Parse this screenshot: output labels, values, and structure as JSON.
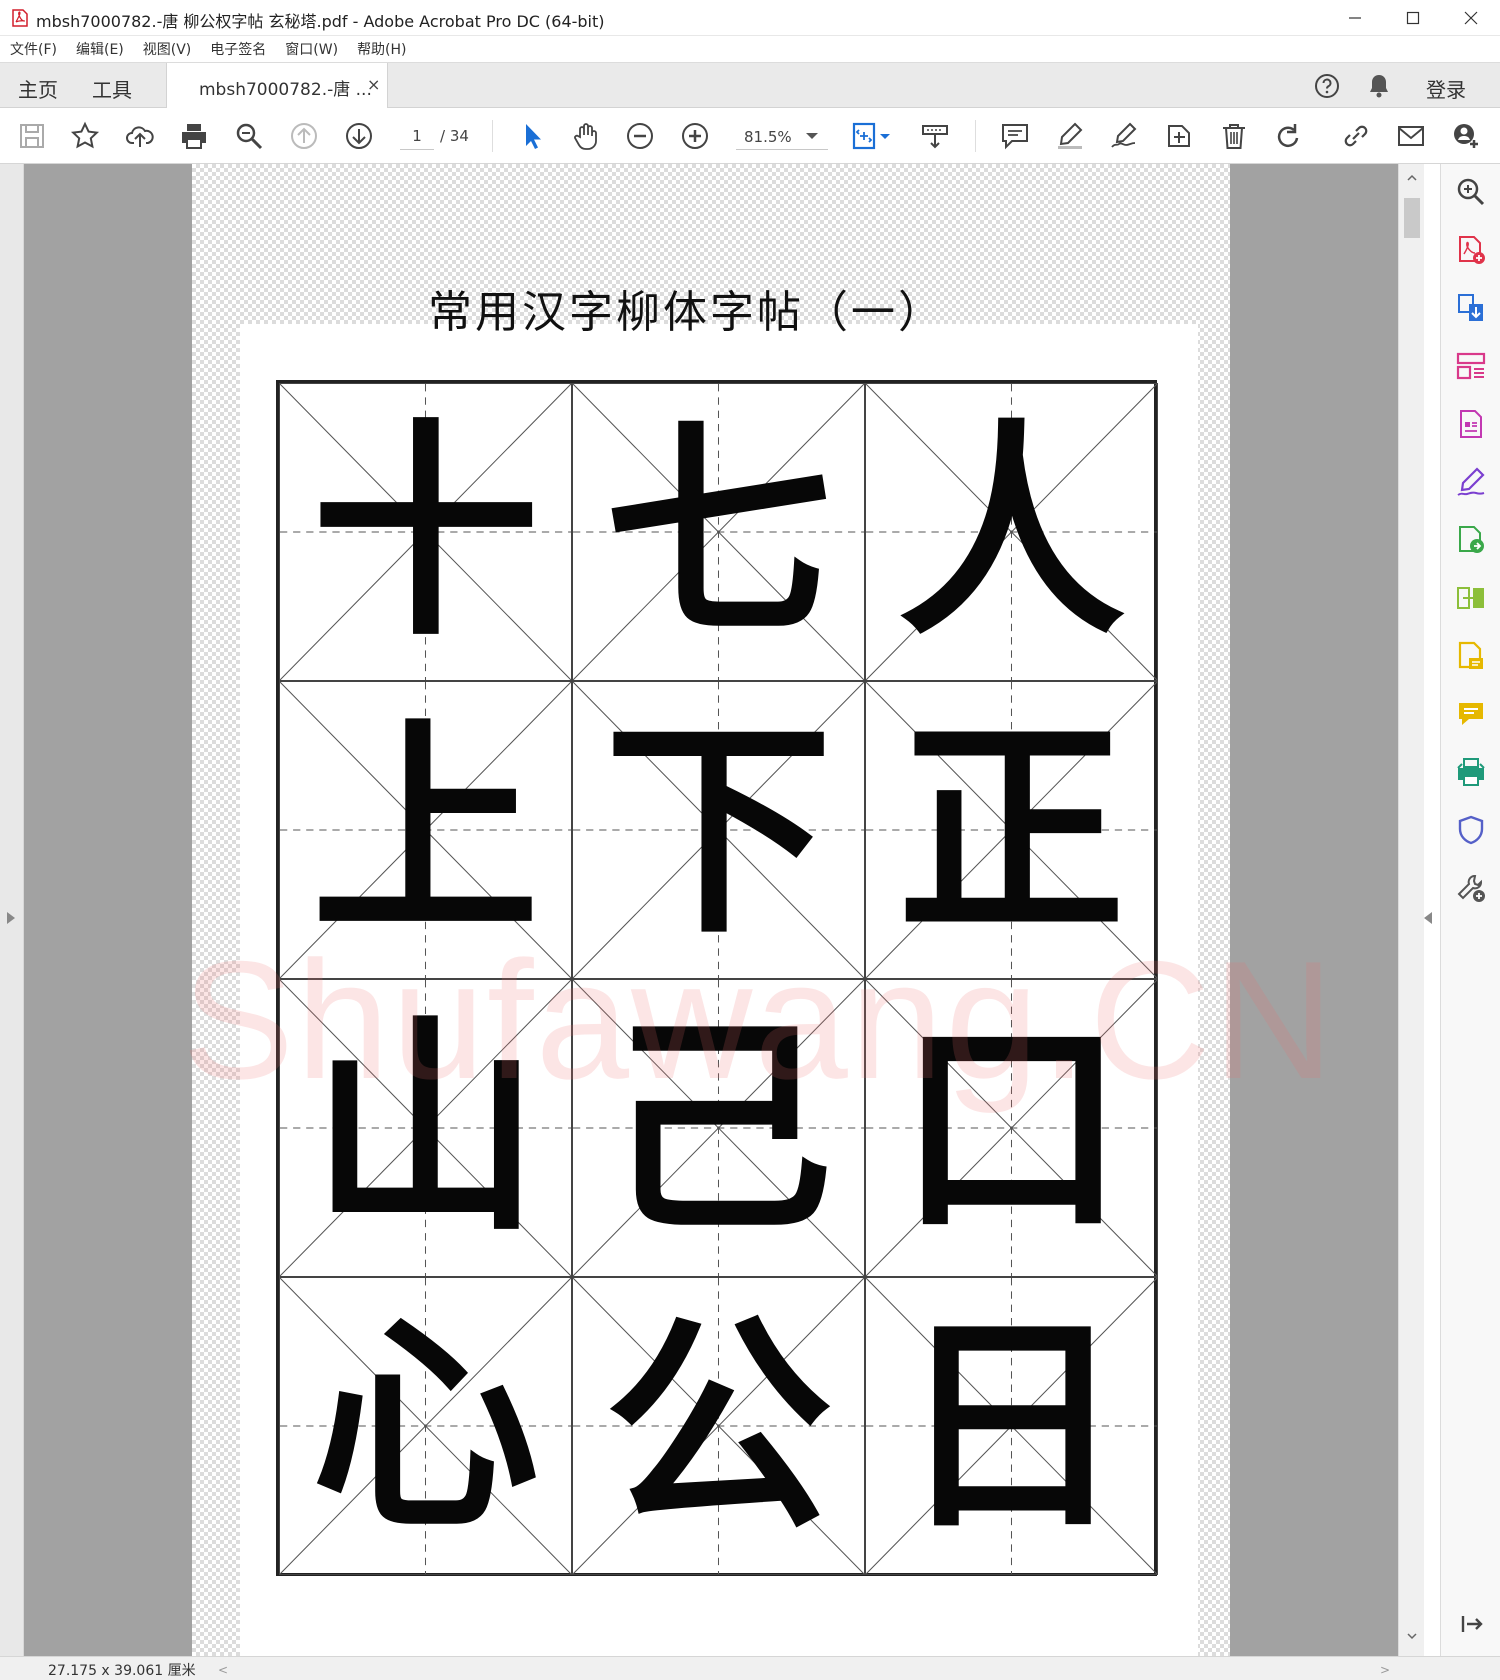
{
  "window": {
    "title": "mbsh7000782.-唐 柳公权字帖 玄秘塔.pdf - Adobe Acrobat Pro DC (64-bit)",
    "controls": [
      "minimize",
      "maximize",
      "close"
    ]
  },
  "menu": {
    "items": [
      "文件(F)",
      "编辑(E)",
      "视图(V)",
      "电子签名",
      "窗口(W)",
      "帮助(H)"
    ]
  },
  "tabs": {
    "home": "主页",
    "tools": "工具",
    "document": "mbsh7000782.-唐 ...",
    "close_symbol": "×",
    "login": "登录"
  },
  "toolbar": {
    "page_current": "1",
    "page_total": "/ 34",
    "zoom": "81.5%",
    "icons": [
      "save-icon",
      "bookmark-star-icon",
      "upload-cloud-icon",
      "print-icon",
      "find-icon",
      "page-up-icon",
      "page-down-icon",
      "select-arrow-icon",
      "hand-icon",
      "zoom-out-icon",
      "zoom-in-icon",
      "page-display-icon",
      "keyboard-scroll-icon",
      "comment-icon",
      "highlight-pen-icon",
      "sign-icon",
      "stamp-icon",
      "delete-icon",
      "rotate-icon",
      "link-icon",
      "email-icon",
      "add-user-icon"
    ]
  },
  "document": {
    "heading": "常用汉字柳体字帖（一）",
    "characters": [
      [
        "十",
        "七",
        "人"
      ],
      [
        "上",
        "下",
        "正"
      ],
      [
        "山",
        "己",
        "口"
      ],
      [
        "心",
        "公",
        "日"
      ]
    ],
    "watermark": "Shufawang.CN"
  },
  "tools_pane": {
    "icons": [
      "zoom-tool-icon",
      "create-pdf-icon",
      "export-pdf-icon",
      "organize-pages-icon",
      "edit-pdf-icon",
      "fill-sign-icon",
      "send-for-review-icon",
      "compare-files-icon",
      "enhance-scans-icon",
      "comment-tool-icon",
      "print-production-icon",
      "protect-icon",
      "more-tools-icon",
      "collapse-pane-icon"
    ],
    "colors": {
      "red": "#e0334a",
      "blue": "#2b6fd6",
      "pink": "#d9398a",
      "magenta": "#c238b2",
      "purple": "#7b3fd0",
      "green": "#3aa84a",
      "lime": "#8cbf3a",
      "yellow": "#e6b800",
      "teal": "#1f9a7a",
      "indigo": "#5560c8",
      "gray": "#555555"
    }
  },
  "status": {
    "page_size": "27.175 x 39.061 厘米"
  }
}
